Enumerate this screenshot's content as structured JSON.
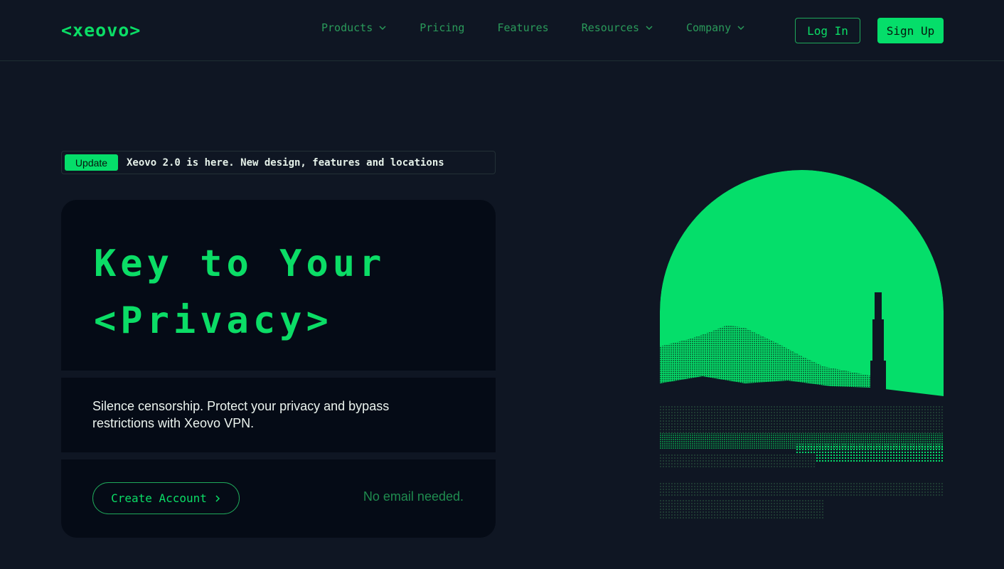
{
  "brand": {
    "logo_text": "<xeovo>",
    "accent_color": "#05de6a",
    "background_color": "#0f1623"
  },
  "nav": {
    "items": [
      {
        "label": "Products",
        "has_dropdown": true
      },
      {
        "label": "Pricing",
        "has_dropdown": false
      },
      {
        "label": "Features",
        "has_dropdown": false
      },
      {
        "label": "Resources",
        "has_dropdown": true
      },
      {
        "label": "Company",
        "has_dropdown": true
      }
    ],
    "login_label": "Log In",
    "signup_label": "Sign Up"
  },
  "update": {
    "badge": "Update",
    "text": "Xeovo 2.0 is here. New design, features and locations"
  },
  "hero": {
    "headline_line1": "Key to Your",
    "headline_line2": "<Privacy>",
    "description": "Silence censorship. Protect your privacy and bypass restrictions with Xeovo VPN.",
    "cta_label": "Create Account",
    "cta_icon": "chevron-right-icon",
    "note": "No email needed."
  },
  "illustration": {
    "name": "pixel-mountain-arch-illustration"
  }
}
